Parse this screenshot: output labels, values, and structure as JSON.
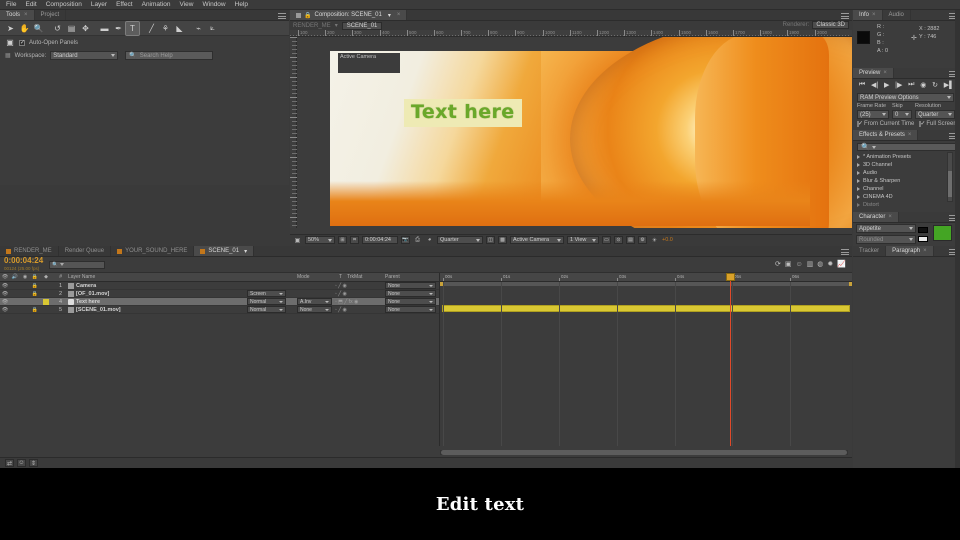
{
  "app": {
    "name": "Adobe After Effects"
  },
  "menubar": {
    "items": [
      "File",
      "Edit",
      "Composition",
      "Layer",
      "Effect",
      "Animation",
      "View",
      "Window",
      "Help"
    ]
  },
  "tools_panel": {
    "tabs": [
      {
        "label": "Tools",
        "active": true
      },
      {
        "label": "Project",
        "active": false
      }
    ],
    "tools": [
      {
        "name": "selection-tool",
        "glyph": "➤",
        "selected": false
      },
      {
        "name": "hand-tool",
        "glyph": "✋",
        "selected": false
      },
      {
        "name": "zoom-tool",
        "glyph": "🔍",
        "selected": false
      },
      {
        "name": "rotation-tool",
        "glyph": "↺",
        "selected": false
      },
      {
        "name": "unified-camera-tool",
        "glyph": "▤",
        "selected": false
      },
      {
        "name": "pan-behind-tool",
        "glyph": "✥",
        "selected": false
      },
      {
        "name": "rectangle-tool",
        "glyph": "▬",
        "selected": false
      },
      {
        "name": "pen-tool",
        "glyph": "✒",
        "selected": false
      },
      {
        "name": "type-tool",
        "glyph": "T",
        "selected": true
      },
      {
        "name": "brush-tool",
        "glyph": "╱",
        "selected": false
      },
      {
        "name": "clone-stamp-tool",
        "glyph": "⚘",
        "selected": false
      },
      {
        "name": "eraser-tool",
        "glyph": "◣",
        "selected": false
      },
      {
        "name": "roto-brush-tool",
        "glyph": "⌁",
        "selected": false
      },
      {
        "name": "puppet-pin-tool",
        "glyph": "⟀",
        "selected": false
      }
    ],
    "auto_open_panels": {
      "label": "Auto-Open Panels",
      "checked": true
    },
    "workspace": {
      "label": "Workspace:",
      "value": "Standard"
    },
    "search_help": {
      "placeholder": "Search Help",
      "value": ""
    }
  },
  "composition_panel": {
    "tab_label": "Composition: SCENE_01",
    "breadcrumb": {
      "parent": "RENDER_ME",
      "current": "SCENE_01"
    },
    "renderer_label": "Renderer:",
    "renderer_value": "Classic 3D",
    "view_overlay_label": "Active Camera",
    "canvas_text": "Text here",
    "ruler_ticks": [
      "100",
      "200",
      "300",
      "400",
      "500",
      "600",
      "700",
      "800",
      "900",
      "1000",
      "1100",
      "1200",
      "1300",
      "1400",
      "1500",
      "1600",
      "1700",
      "1800",
      "1900",
      "2000"
    ],
    "status_bar": {
      "magnification": "50%",
      "timecode": "0:00:04:24",
      "resolution": "Quarter",
      "camera": "Active Camera",
      "views": "1 View",
      "exposure": "+0.0"
    }
  },
  "info_panel": {
    "tabs": [
      {
        "label": "Info",
        "active": true
      },
      {
        "label": "Audio",
        "active": false
      }
    ],
    "channels": [
      "R :",
      "G :",
      "B :",
      "A : 0"
    ],
    "coords": {
      "x": "X : 2882",
      "y": "Y : 746"
    }
  },
  "preview_panel": {
    "tab_label": "Preview",
    "transport": [
      {
        "name": "first-frame-button",
        "glyph": "⏮"
      },
      {
        "name": "previous-frame-button",
        "glyph": "◀|"
      },
      {
        "name": "play-button",
        "glyph": "▶"
      },
      {
        "name": "next-frame-button",
        "glyph": "|▶"
      },
      {
        "name": "last-frame-button",
        "glyph": "⏭"
      },
      {
        "name": "audio-button",
        "glyph": "◉"
      },
      {
        "name": "loop-button",
        "glyph": "↻"
      },
      {
        "name": "ram-preview-button",
        "glyph": "▶▌"
      }
    ],
    "options_label": "RAM Preview Options",
    "frame_rate": {
      "label": "Frame Rate",
      "value": "(25)"
    },
    "skip": {
      "label": "Skip",
      "value": "0"
    },
    "resolution": {
      "label": "Resolution",
      "value": "Quarter"
    },
    "from_current_time": {
      "label": "From Current Time",
      "checked": true
    },
    "full_screen": {
      "label": "Full Screen",
      "checked": true
    }
  },
  "effects_panel": {
    "tab_label": "Effects & Presets",
    "search_placeholder": "",
    "items": [
      "* Animation Presets",
      "3D Channel",
      "Audio",
      "Blur & Sharpen",
      "Channel",
      "CINEMA 4D",
      "Distort"
    ]
  },
  "character_panel": {
    "tab_label": "Character",
    "font_family": "Appetite",
    "font_style": "Rounded",
    "fill_color": "#44a524",
    "stroke_color": "#ffffff"
  },
  "bottom_right_panel": {
    "tabs": [
      {
        "label": "Tracker",
        "active": false
      },
      {
        "label": "Paragraph",
        "active": true
      }
    ]
  },
  "timeline": {
    "tabs": [
      {
        "label": "RENDER_ME",
        "active": false
      },
      {
        "label": "Render Queue",
        "active": false
      },
      {
        "label": "YOUR_SOUND_HERE",
        "active": false
      },
      {
        "label": "SCENE_01",
        "active": true
      }
    ],
    "timecode": "0:00:04:24",
    "frame_info": "00124 (25.00 fps)",
    "search_placeholder": "",
    "columns": [
      "Layer Name",
      "Mode",
      "T",
      "TrkMat",
      "Parent"
    ],
    "layers": [
      {
        "num": "1",
        "name": "Camera",
        "icon": "camera-icon",
        "mode": "",
        "trkmat": "",
        "parent": "None",
        "selected": false,
        "has_bar": false
      },
      {
        "num": "2",
        "name": "[OF_01.mov]",
        "icon": "footage-icon",
        "mode": "Screen",
        "trkmat": "",
        "parent": "None",
        "selected": false,
        "has_bar": false
      },
      {
        "num": "4",
        "name": "Text here",
        "icon": "text-icon",
        "mode": "Normal",
        "trkmat": "A.Inv",
        "parent": "None",
        "selected": true,
        "has_bar": true
      },
      {
        "num": "5",
        "name": "[SCENE_01.mov]",
        "icon": "footage-icon",
        "mode": "Normal",
        "trkmat": "None",
        "parent": "None",
        "selected": false,
        "has_bar": false
      }
    ],
    "ruler_labels": [
      "00s",
      "01s",
      "02s",
      "03s",
      "04s",
      "05s",
      "06s"
    ],
    "playhead_time": "0:00:04:24"
  },
  "caption": {
    "text": "Edit text"
  },
  "colors": {
    "accent_orange": "#c3771b",
    "timecode_orange": "#d79a2b",
    "layer_bar_yellow": "#d9c833",
    "playhead_red": "#e04a2a",
    "text_green": "#6aa82a",
    "panel_bg": "#3c3c3c"
  }
}
